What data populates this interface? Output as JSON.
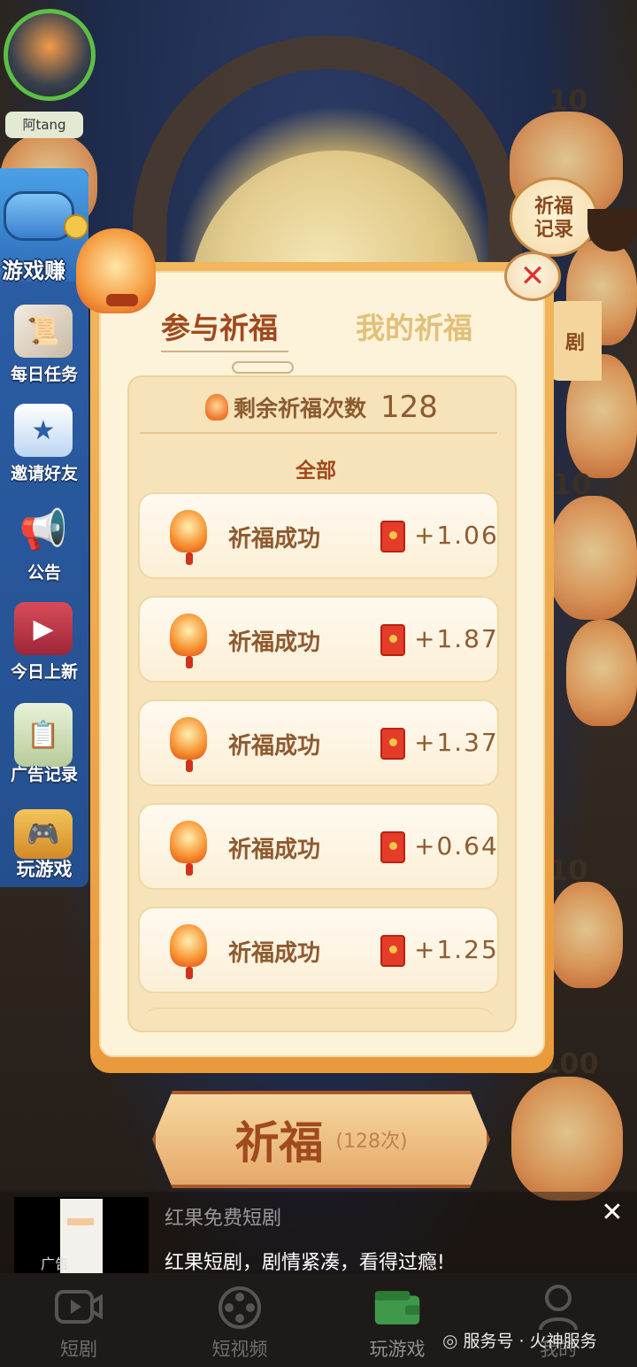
{
  "user": {
    "name": "阿tang"
  },
  "sidebar": {
    "items": [
      {
        "label": "游戏赚",
        "icon": "gamepad-icon"
      },
      {
        "label": "每日任务",
        "icon": "scroll-icon"
      },
      {
        "label": "邀请好友",
        "icon": "invite-icon"
      },
      {
        "label": "公告",
        "icon": "megaphone-icon"
      },
      {
        "label": "今日上新",
        "icon": "book-icon"
      },
      {
        "label": "广告记录",
        "icon": "clipboard-icon"
      },
      {
        "label": "玩游戏",
        "icon": "controller-icon"
      }
    ]
  },
  "right": {
    "record_label_1": "祈福",
    "record_label_2": "记录",
    "tab_label": "剧"
  },
  "background_numbers": [
    "10",
    "10",
    "10",
    "100"
  ],
  "modal": {
    "tab_join": "参与祈福",
    "tab_mine": "我的祈福",
    "remaining_label": "剩余祈福次数",
    "remaining_count": "128",
    "filter": "全部",
    "records": [
      {
        "title": "祈福成功",
        "amount": "+1.06"
      },
      {
        "title": "祈福成功",
        "amount": "+1.87"
      },
      {
        "title": "祈福成功",
        "amount": "+1.37"
      },
      {
        "title": "祈福成功",
        "amount": "+0.64"
      },
      {
        "title": "祈福成功",
        "amount": "+1.25"
      }
    ]
  },
  "pray_button": {
    "label": "祈福",
    "sub": "(128次)"
  },
  "ad": {
    "tag": "广告",
    "title": "红果免费短剧",
    "desc": "红果短剧，剧情紧凑，看得过瘾!"
  },
  "tabbar": {
    "items": [
      {
        "label": "短剧",
        "icon": "video-icon"
      },
      {
        "label": "短视频",
        "icon": "film-reel-icon"
      },
      {
        "label": "玩游戏",
        "icon": "wallet-icon"
      },
      {
        "label": "我的",
        "icon": "person-icon"
      }
    ]
  },
  "watermark": "服务号 · 火神服务"
}
